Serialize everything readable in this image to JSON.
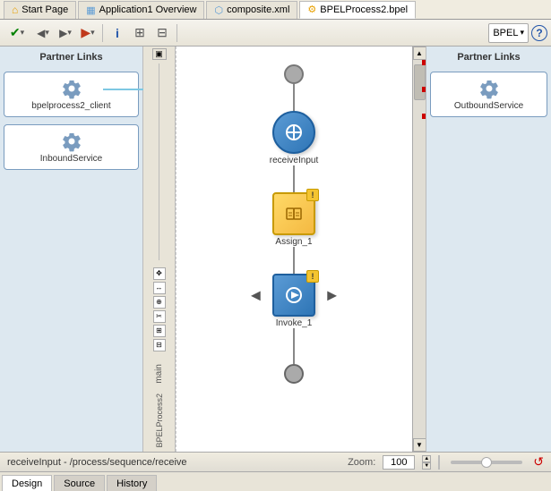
{
  "tabs": [
    {
      "id": "start-page",
      "label": "Start Page",
      "icon": "home"
    },
    {
      "id": "app-overview",
      "label": "Application1 Overview",
      "icon": "app"
    },
    {
      "id": "composite",
      "label": "composite.xml",
      "icon": "composite"
    },
    {
      "id": "bpel-process",
      "label": "BPELProcess2.bpel",
      "icon": "bpel",
      "active": true
    }
  ],
  "toolbar": {
    "save_label": "✔",
    "dropdown1_label": "BPEL",
    "dropdown2_label": "",
    "help_label": "?"
  },
  "left_panel": {
    "title": "Partner Links",
    "items": [
      {
        "label": "bpelprocess2_client"
      },
      {
        "label": "InboundService"
      }
    ]
  },
  "right_panel": {
    "title": "Partner Links",
    "items": [
      {
        "label": "OutboundService"
      }
    ]
  },
  "canvas": {
    "lane_label": "main",
    "bpel_label": "BPELProcess2",
    "nodes": [
      {
        "type": "start",
        "id": "start-circle"
      },
      {
        "type": "receive",
        "label": "receiveInput",
        "id": "receive-node"
      },
      {
        "type": "assign",
        "label": "Assign_1",
        "id": "assign-node",
        "warning": true
      },
      {
        "type": "invoke",
        "label": "Invoke_1",
        "id": "invoke-node",
        "warning": true
      },
      {
        "type": "end",
        "id": "end-circle"
      }
    ]
  },
  "status_bar": {
    "path": "receiveInput - /process/sequence/receive",
    "zoom_label": "Zoom:",
    "zoom_value": "100",
    "reset_icon": "↺"
  },
  "bottom_tabs": [
    {
      "label": "Design",
      "active": true
    },
    {
      "label": "Source",
      "active": false
    },
    {
      "label": "History",
      "active": false
    }
  ]
}
